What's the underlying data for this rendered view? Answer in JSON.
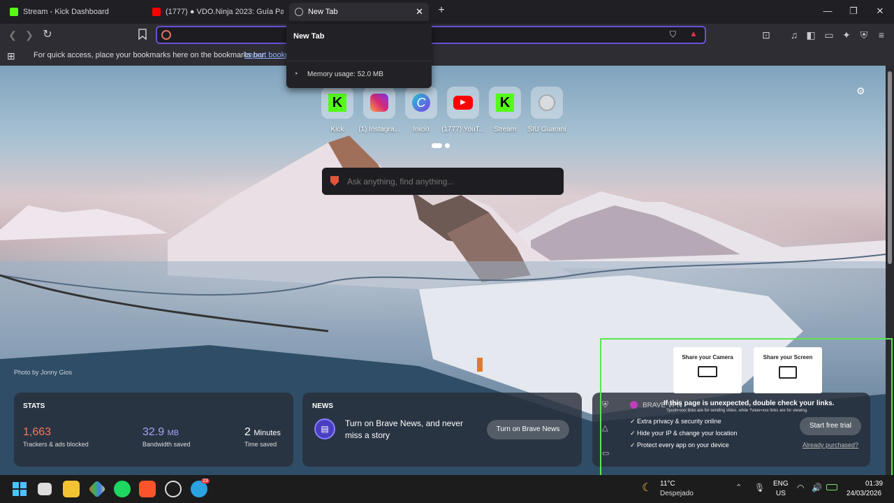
{
  "tabs": [
    {
      "title": "Stream - Kick Dashboard"
    },
    {
      "title": "(1777) ● VDO.Ninja 2023: Guía Paso"
    },
    {
      "title": "New Tab"
    }
  ],
  "tab_popup": {
    "title": "New Tab",
    "memory": "Memory usage: 52.0 MB"
  },
  "url_bar": {
    "value": ""
  },
  "bookmarks_bar": {
    "message": "For quick access, place your bookmarks here on the bookmarks bar.",
    "import_link": "Import bookm"
  },
  "top_sites": [
    {
      "label": "Kick",
      "icon": "kick-icon"
    },
    {
      "label": "(1) Instagra...",
      "icon": "instagram-icon"
    },
    {
      "label": "Inicio",
      "icon": "canva-icon"
    },
    {
      "label": "(1777) YouT...",
      "icon": "youtube-icon"
    },
    {
      "label": "Stream",
      "icon": "kick-icon"
    },
    {
      "label": "SIU Guarani",
      "icon": "globe-icon"
    }
  ],
  "search": {
    "placeholder": "Ask anything, find anything..."
  },
  "photo_credit": "Photo by Jonny Gios",
  "stats": {
    "heading": "STATS",
    "items": [
      {
        "value": "1,663",
        "unit": "",
        "label": "Trackers & ads blocked",
        "color": "#f2795c"
      },
      {
        "value": "32.9",
        "unit": "MB",
        "label": "Bandwidth saved",
        "color": "#a9a3f5"
      },
      {
        "value": "2",
        "unit": "Minutes",
        "label": "Time saved",
        "color": "#ffffff"
      }
    ]
  },
  "news": {
    "heading": "NEWS",
    "text": "Turn on Brave News, and never miss a story",
    "button": "Turn on Brave News"
  },
  "vpn": {
    "brand": "BRAVE VPN",
    "warning": "If this page is unexpected, double check your links.",
    "warning_sub": "?push=xxx links are for sending video, while ?view=xxx links are for viewing.",
    "features": [
      "Extra privacy & security online",
      "Hide your IP & change your location",
      "Protect every app on your device"
    ],
    "trial_button": "Start free trial",
    "purchased_link": "Already purchased?"
  },
  "overlay": {
    "camera": "Share your Camera",
    "screen": "Share your Screen"
  },
  "taskbar": {
    "weather_temp": "11°C",
    "weather_desc": "Despejado",
    "lang1": "ENG",
    "lang2": "US",
    "time": "01:39",
    "date": "24/03/2026",
    "badge": "23"
  }
}
